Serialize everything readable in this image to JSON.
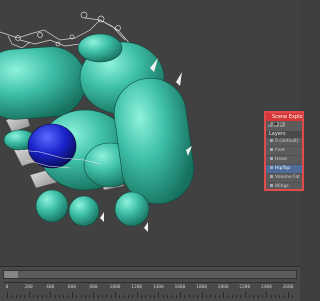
{
  "layer_panel": {
    "title": "Scene Explorer - Layer Explorer",
    "column_header": "Layers",
    "toolbar_icons": [
      "filter-icon",
      "display-icon",
      "search-icon"
    ],
    "layers": [
      {
        "name": "0 (default)",
        "selected": false
      },
      {
        "name": "Feet",
        "selected": false
      },
      {
        "name": "Head",
        "selected": false
      },
      {
        "name": "HipTop",
        "selected": true
      },
      {
        "name": "Volume Fat",
        "selected": false
      },
      {
        "name": "Wings",
        "selected": false
      }
    ]
  },
  "timeline": {
    "tick_labels": [
      "0",
      "200",
      "400",
      "600",
      "800",
      "1000",
      "1200",
      "1400",
      "1600",
      "1800",
      "2000",
      "2200",
      "2400",
      "2600"
    ]
  },
  "colors": {
    "viewport_bg": "#414141",
    "bone_teal": "#3fc0a8",
    "selection_blue": "#1a22c8",
    "panel_border": "#e24b4b"
  }
}
